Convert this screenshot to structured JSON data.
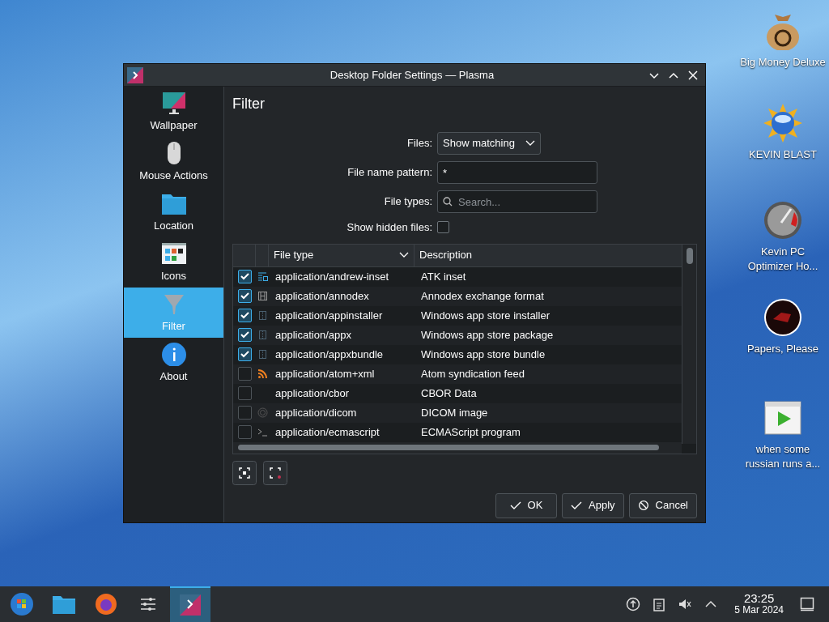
{
  "desktop_icons": [
    {
      "label": "Big Money Deluxe",
      "kind": "moneybag"
    },
    {
      "label": "KEVIN BLAST",
      "kind": "sun"
    },
    {
      "label": "Kevin PC Optimizer Ho...",
      "kind": "gauge"
    },
    {
      "label": "Papers, Please",
      "kind": "seal"
    },
    {
      "label": "when some russian runs a...",
      "kind": "video"
    }
  ],
  "window": {
    "title": "Desktop Folder Settings — Plasma"
  },
  "sidebar": {
    "items": [
      {
        "label": "Wallpaper",
        "kind": "monitor",
        "selected": false
      },
      {
        "label": "Mouse Actions",
        "kind": "mouse",
        "selected": false
      },
      {
        "label": "Location",
        "kind": "folder",
        "selected": false
      },
      {
        "label": "Icons",
        "kind": "grid",
        "selected": false
      },
      {
        "label": "Filter",
        "kind": "funnel",
        "selected": true
      },
      {
        "label": "About",
        "kind": "info",
        "selected": false
      }
    ]
  },
  "page_title": "Filter",
  "form": {
    "files": {
      "label": "Files:",
      "value": "Show matching"
    },
    "pattern": {
      "label": "File name pattern:",
      "value": "*"
    },
    "types": {
      "label": "File types:",
      "placeholder": "Search..."
    },
    "hidden": {
      "label": "Show hidden files:",
      "checked": false
    }
  },
  "table": {
    "columns": [
      "File type",
      "Description"
    ],
    "rows": [
      {
        "checked": true,
        "kind": "inset",
        "file_type": "application/andrew-inset",
        "description": "ATK inset"
      },
      {
        "checked": true,
        "kind": "film",
        "file_type": "application/annodex",
        "description": "Annodex exchange format"
      },
      {
        "checked": true,
        "kind": "archive",
        "file_type": "application/appinstaller",
        "description": "Windows app store installer"
      },
      {
        "checked": true,
        "kind": "archive",
        "file_type": "application/appx",
        "description": "Windows app store package"
      },
      {
        "checked": true,
        "kind": "archive",
        "file_type": "application/appxbundle",
        "description": "Windows app store bundle"
      },
      {
        "checked": false,
        "kind": "feed",
        "file_type": "application/atom+xml",
        "description": "Atom syndication feed"
      },
      {
        "checked": false,
        "kind": "none",
        "file_type": "application/cbor",
        "description": "CBOR Data"
      },
      {
        "checked": false,
        "kind": "disc",
        "file_type": "application/dicom",
        "description": "DICOM image"
      },
      {
        "checked": false,
        "kind": "script",
        "file_type": "application/ecmascript",
        "description": "ECMAScript program"
      }
    ]
  },
  "buttons": [
    {
      "label": "OK",
      "kind": "ok"
    },
    {
      "label": "Apply",
      "kind": "apply"
    },
    {
      "label": "Cancel",
      "kind": "cancel"
    }
  ],
  "taskbar": {
    "apps": [
      {
        "kind": "start",
        "selected": false
      },
      {
        "kind": "folder",
        "selected": false
      },
      {
        "kind": "browser",
        "selected": false
      },
      {
        "kind": "settings",
        "selected": false
      },
      {
        "kind": "plasma",
        "selected": true
      }
    ],
    "time": "23:25",
    "date": "5 Mar 2024"
  }
}
